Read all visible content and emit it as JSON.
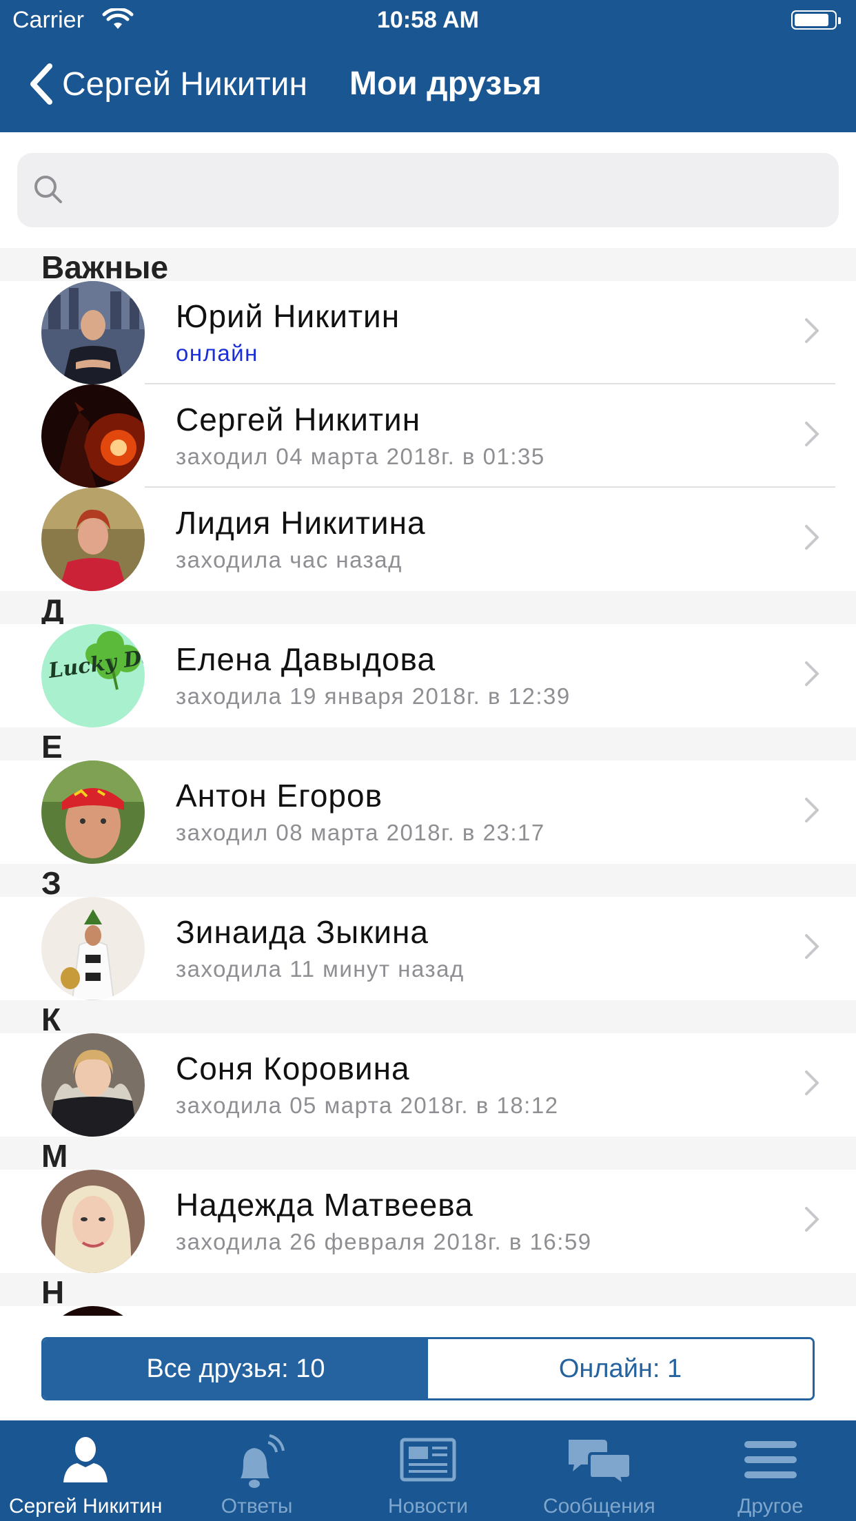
{
  "status_bar": {
    "carrier": "Carrier",
    "time": "10:58 AM"
  },
  "nav": {
    "back_label": "Сергей Никитин",
    "title": "Мои друзья"
  },
  "search": {
    "placeholder": ""
  },
  "sections": [
    {
      "header": "Важные",
      "rows": [
        {
          "name": "Юрий Никитин",
          "status": "онлайн",
          "online": true,
          "avatar": "photo-man-city"
        },
        {
          "name": "Сергей Никитин",
          "status": "заходил 04 марта 2018г. в 01:35",
          "online": false,
          "avatar": "photo-fire-wolf"
        },
        {
          "name": "Лидия Никитина",
          "status": "заходила час назад",
          "online": false,
          "avatar": "photo-woman-red"
        }
      ]
    },
    {
      "header": "Д",
      "rows": [
        {
          "name": "Елена Давыдова",
          "status": "заходила 19 января 2018г. в 12:39",
          "online": false,
          "avatar": "lucky-day-clover",
          "avatar_text": "Lucky Day"
        }
      ]
    },
    {
      "header": "Е",
      "rows": [
        {
          "name": "Антон Егоров",
          "status": "заходил 08 марта 2018г. в 23:17",
          "online": false,
          "avatar": "photo-man-bandana"
        }
      ]
    },
    {
      "header": "З",
      "rows": [
        {
          "name": "Зинаида Зыкина",
          "status": "заходила 11 минут назад",
          "online": false,
          "avatar": "photo-woman-beach"
        }
      ]
    },
    {
      "header": "К",
      "rows": [
        {
          "name": "Соня Коровина",
          "status": "заходила 05 марта 2018г. в 18:12",
          "online": false,
          "avatar": "photo-woman-fur"
        }
      ]
    },
    {
      "header": "М",
      "rows": [
        {
          "name": "Надежда Матвеева",
          "status": "заходила 26 февраля 2018г. в 16:59",
          "online": false,
          "avatar": "photo-woman-blonde"
        }
      ]
    },
    {
      "header": "Н",
      "rows": []
    }
  ],
  "segmented": {
    "all_friends": "Все друзья: 10",
    "online": "Онлайн: 1",
    "selected": "all_friends"
  },
  "tabbar": [
    {
      "label": "Сергей Никитин",
      "icon": "person-icon",
      "active": true
    },
    {
      "label": "Ответы",
      "icon": "bell-icon",
      "active": false
    },
    {
      "label": "Новости",
      "icon": "newspaper-icon",
      "active": false
    },
    {
      "label": "Сообщения",
      "icon": "chat-bubbles-icon",
      "active": false
    },
    {
      "label": "Другое",
      "icon": "menu-icon",
      "active": false
    }
  ],
  "colors": {
    "brand": "#1a5691",
    "segment_active": "#2563a0",
    "online_status": "#1b2fd6",
    "tab_inactive": "#7fa6cc"
  }
}
